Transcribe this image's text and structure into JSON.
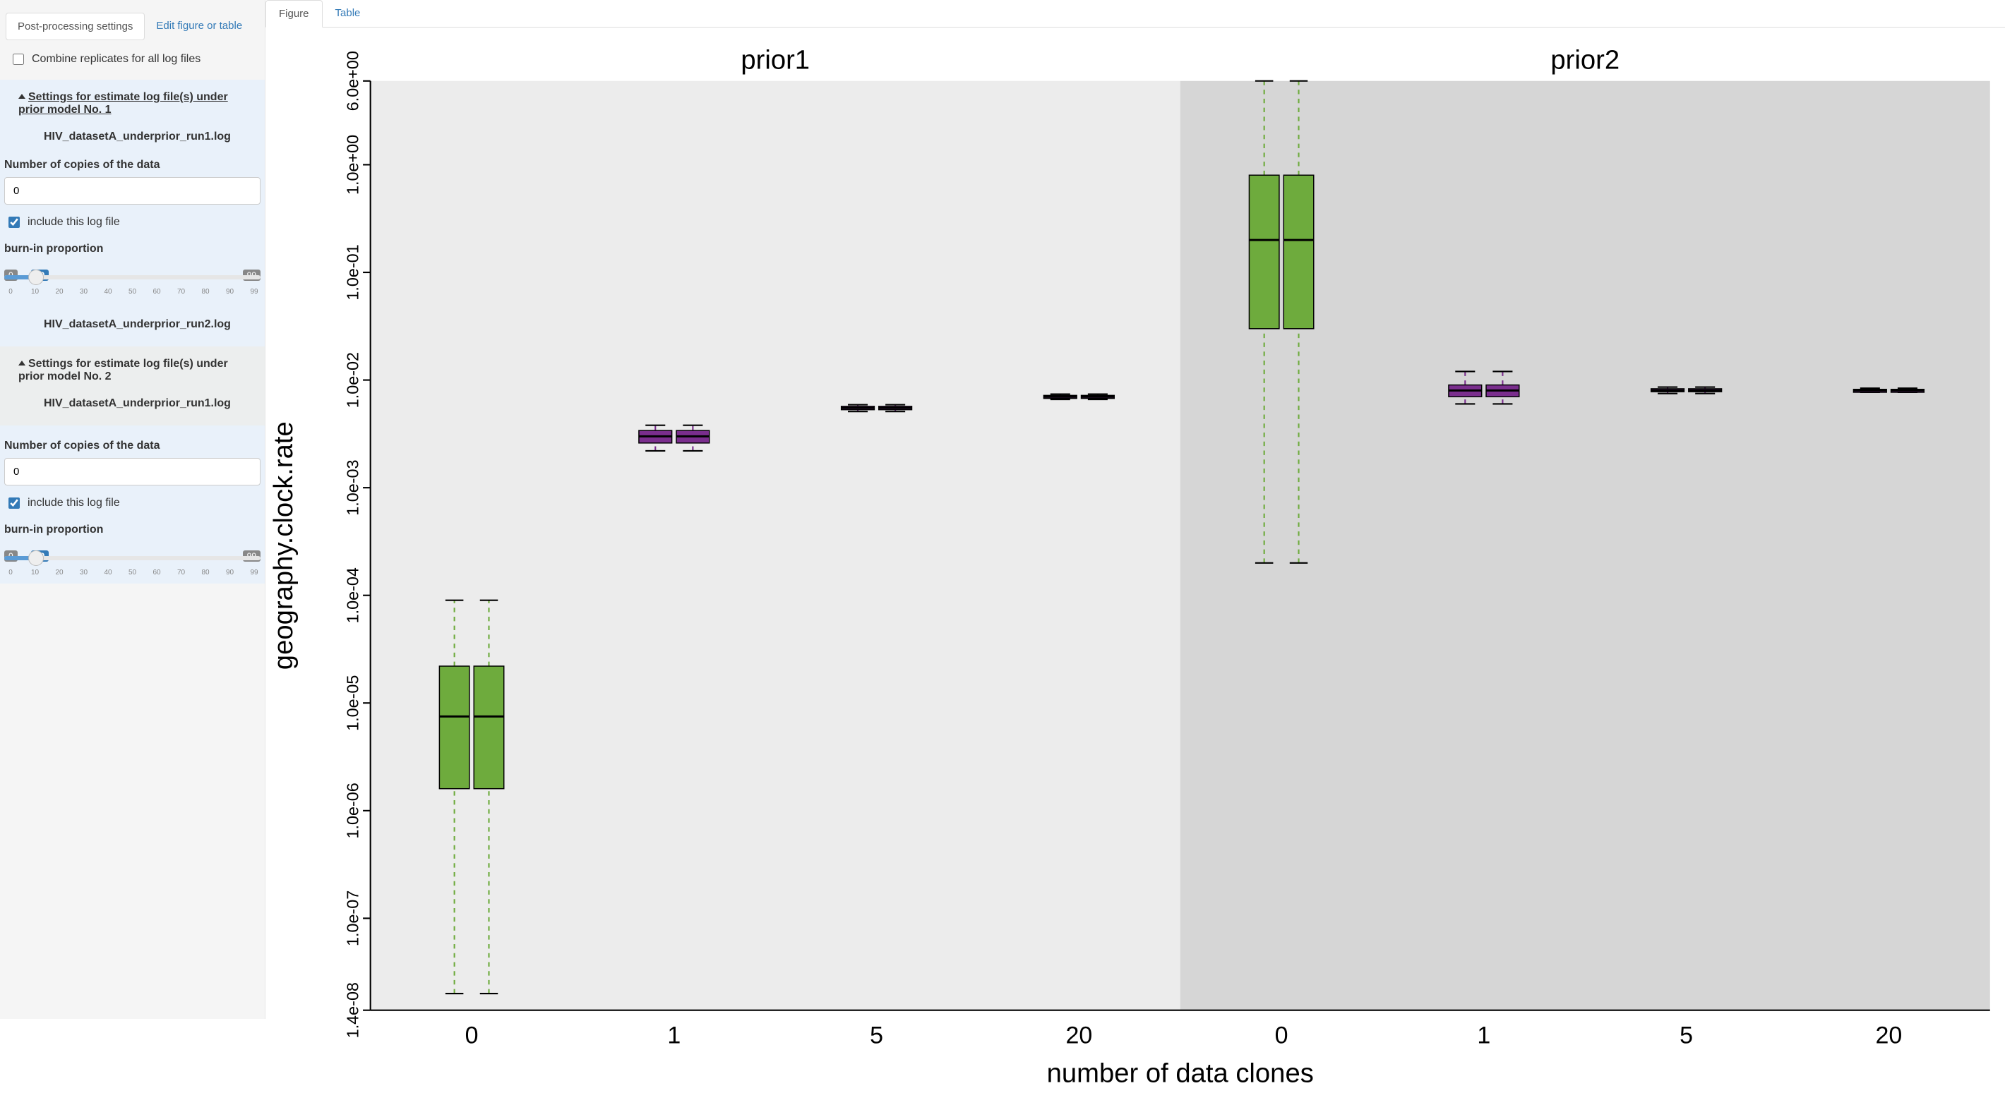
{
  "sidebar_tabs": {
    "post": "Post-processing settings",
    "edit": "Edit figure or table"
  },
  "combine_label": "Combine replicates for all log files",
  "combine_checked": false,
  "section1_title": "Settings for estimate log file(s) under prior model No. 1",
  "section2_title": "Settings for estimate log file(s) under prior model No. 2",
  "file1a": "HIV_datasetA_underprior_run1.log",
  "file1b": "HIV_datasetA_underprior_run2.log",
  "file2a": "HIV_datasetA_underprior_run1.log",
  "copies_label": "Number of copies of the data",
  "copies_value_1": "0",
  "copies_value_2": "0",
  "include_label": "include this log file",
  "include_checked": true,
  "burnin_label": "burn-in proportion",
  "slider": {
    "min": "0",
    "cur": "10",
    "max": "99",
    "ticks": [
      "0",
      "10",
      "20",
      "30",
      "40",
      "50",
      "60",
      "70",
      "80",
      "90",
      "99"
    ]
  },
  "main_tabs": {
    "figure": "Figure",
    "table": "Table"
  },
  "chart_data": {
    "type": "boxplot",
    "ylabel": "geography.clock.rate",
    "xlabel": "number of data clones",
    "facets": [
      "prior1",
      "prior2"
    ],
    "categories": [
      "0",
      "1",
      "5",
      "20"
    ],
    "yscale": "log10",
    "ylim": [
      1.4e-08,
      6.0
    ],
    "yticks": [
      "1.4e-08",
      "1.0e-07",
      "1.0e-06",
      "1.0e-05",
      "1.0e-04",
      "1.0e-03",
      "1.0e-02",
      "1.0e-01",
      "1.0e+00",
      "6.0e+00"
    ],
    "yticks_num": [
      1.4e-08,
      1e-07,
      1e-06,
      1e-05,
      0.0001,
      0.001,
      0.01,
      0.1,
      1.0,
      6.0
    ],
    "series_per_category": 2,
    "facet_data": {
      "prior1": {
        "0": {
          "median": 7.5e-06,
          "q1": 1.6e-06,
          "q3": 2.2e-05,
          "low": 2e-08,
          "high": 9e-05,
          "color": "green"
        },
        "1": {
          "median": 0.003,
          "q1": 0.0026,
          "q3": 0.0034,
          "low": 0.0022,
          "high": 0.0038,
          "color": "purple"
        },
        "5": {
          "median": 0.0055,
          "q1": 0.0053,
          "q3": 0.0057,
          "low": 0.0051,
          "high": 0.0059,
          "color": "purple"
        },
        "20": {
          "median": 0.007,
          "q1": 0.0068,
          "q3": 0.0072,
          "low": 0.0066,
          "high": 0.0074,
          "color": "purple"
        }
      },
      "prior2": {
        "0": {
          "median": 0.2,
          "q1": 0.03,
          "q3": 0.8,
          "low": 0.0002,
          "high": 6.0,
          "color": "green"
        },
        "1": {
          "median": 0.008,
          "q1": 0.007,
          "q3": 0.009,
          "low": 0.006,
          "high": 0.012,
          "color": "purple"
        },
        "5": {
          "median": 0.008,
          "q1": 0.0078,
          "q3": 0.0083,
          "low": 0.0075,
          "high": 0.0086,
          "color": "purple"
        },
        "20": {
          "median": 0.008,
          "q1": 0.0079,
          "q3": 0.0082,
          "low": 0.0077,
          "high": 0.0084,
          "color": "purple"
        }
      }
    }
  }
}
